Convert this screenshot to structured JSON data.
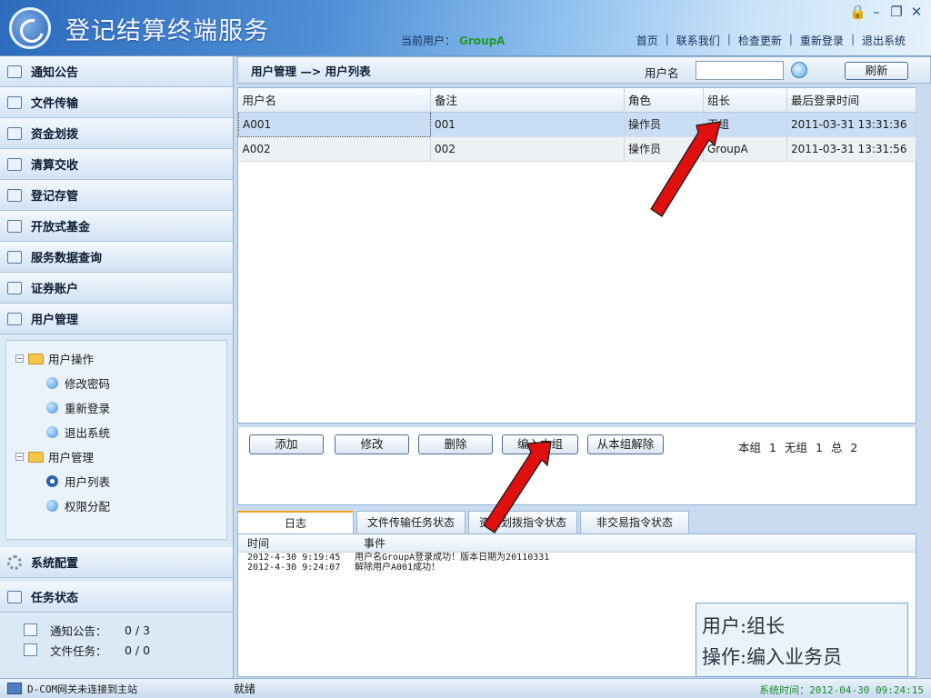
{
  "app": {
    "title": "登记结算终端服务",
    "current_user_label": "当前用户：",
    "current_user": "GroupA"
  },
  "topnav": [
    "首页",
    "联系我们",
    "检查更新",
    "重新登录",
    "退出系统"
  ],
  "window_controls": [
    "lock",
    "minimize",
    "restore",
    "close"
  ],
  "sidebar": {
    "items": [
      {
        "label": "通知公告",
        "icon": "notice-icon"
      },
      {
        "label": "文件传输",
        "icon": "file-transfer-icon"
      },
      {
        "label": "资金划拨",
        "icon": "funds-icon"
      },
      {
        "label": "清算交收",
        "icon": "clearing-icon"
      },
      {
        "label": "登记存管",
        "icon": "registry-icon"
      },
      {
        "label": "开放式基金",
        "icon": "fund-icon"
      },
      {
        "label": "服务数据查询",
        "icon": "query-icon"
      },
      {
        "label": "证券账户",
        "icon": "account-icon"
      },
      {
        "label": "用户管理",
        "icon": "users-icon"
      }
    ],
    "tree": [
      {
        "label": "用户操作",
        "level": 0
      },
      {
        "label": "修改密码",
        "level": 1
      },
      {
        "label": "重新登录",
        "level": 1
      },
      {
        "label": "退出系统",
        "level": 1
      },
      {
        "label": "用户管理",
        "level": 0
      },
      {
        "label": "用户列表",
        "level": 1,
        "selected": true
      },
      {
        "label": "权限分配",
        "level": 1
      }
    ],
    "system_config": "系统配置",
    "task_status": "任务状态",
    "tasks": [
      {
        "label": "通知公告：",
        "value": "0 / 3"
      },
      {
        "label": "文件任务：",
        "value": "0 / 0"
      }
    ]
  },
  "main": {
    "breadcrumb": "用户管理 —> 用户列表",
    "username_label": "用户名",
    "username_value": "",
    "refresh_label": "刷新",
    "columns": [
      "用户名",
      "备注",
      "角色",
      "组长",
      "最后登录时间"
    ],
    "rows": [
      [
        "A001",
        "001",
        "操作员",
        "无组",
        "2011-03-31 13:31:36"
      ],
      [
        "A002",
        "002",
        "操作员",
        "GroupA",
        "2011-03-31 13:31:56"
      ]
    ],
    "buttons": [
      "添加",
      "修改",
      "删除",
      "编入本组",
      "从本组解除"
    ],
    "counts": {
      "group_label": "本组",
      "group_value": "1",
      "nogroup_label": "无组",
      "nogroup_value": "1",
      "total_label": "总",
      "total_value": "2"
    },
    "tabs": [
      "日志",
      "文件传输任务状态",
      "资金划拨指令状态",
      "非交易指令状态"
    ],
    "log_headers": [
      "时间",
      "事件"
    ],
    "log": [
      {
        "time": "2012-4-30 9:19:45",
        "event": "用户名GroupA登录成功！版本日期为20110331"
      },
      {
        "time": "2012-4-30 9:24:07",
        "event": "解除用户A001成功！"
      }
    ]
  },
  "annotation": {
    "line1": "用户:组长",
    "line2": "操作:编入业务员"
  },
  "status": {
    "gateway": "D-COM网关未连接到主站",
    "ready": "就绪",
    "time_label": "系统时间：",
    "time_value": "2012-04-30 09:24:15"
  },
  "colors": {
    "accent": "#2d6cbd",
    "selected_row": "#c9def5",
    "arrow": "#e01010",
    "time_text": "#1d8a2a"
  }
}
